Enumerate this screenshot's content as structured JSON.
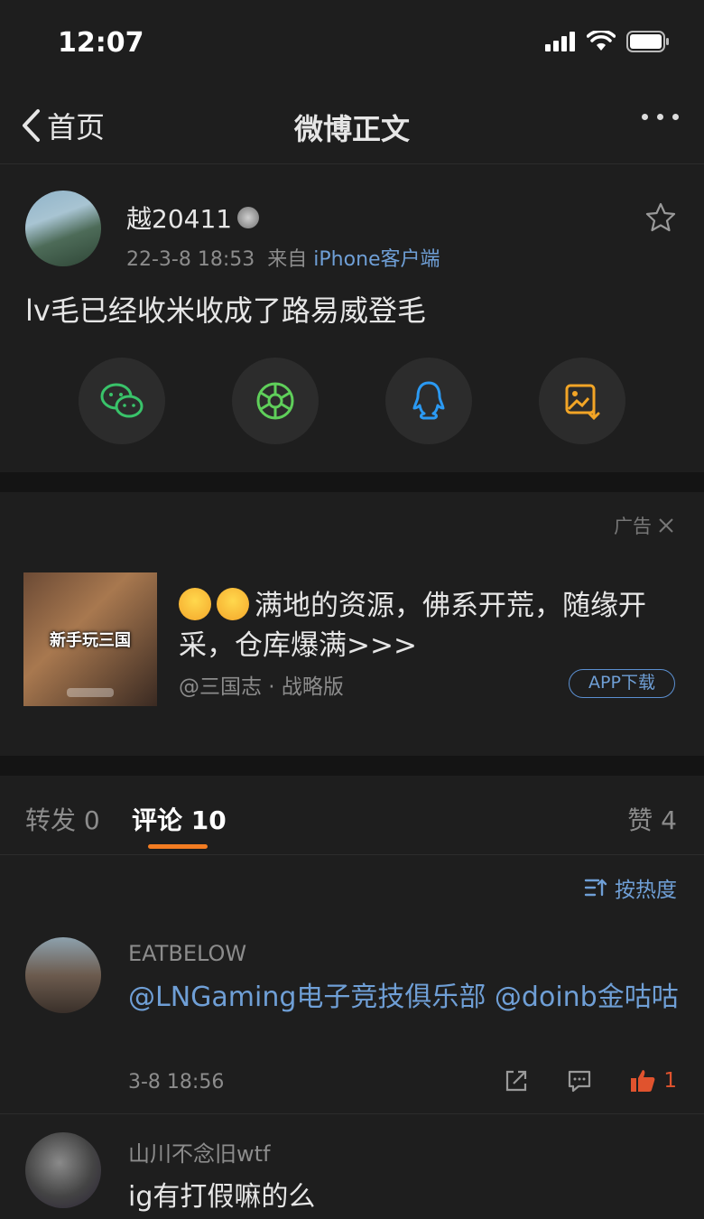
{
  "status_bar": {
    "time": "12:07"
  },
  "nav": {
    "back_label": "首页",
    "title": "微博正文"
  },
  "post": {
    "author": "越20411",
    "time": "22-3-8 18:53",
    "source_prefix": "来自",
    "source": "iPhone客户端",
    "text": "lv毛已经收米收成了路易威登毛",
    "share_icons": [
      "wechat-icon",
      "moments-icon",
      "qq-icon",
      "save-image-icon"
    ]
  },
  "ad": {
    "tag": "广告",
    "image_label": "新手玩三国",
    "text": "满地的资源，佛系开荒，随缘开采，仓库爆满>>>",
    "source": "@三国志 · 战略版",
    "button": "APP下载"
  },
  "tabs": {
    "repost_label": "转发",
    "repost_count": "0",
    "comments_label": "评论",
    "comments_count": "10",
    "likes_label": "赞",
    "likes_count": "4"
  },
  "sort_label": "按热度",
  "comments": [
    {
      "name": "EATBELOW",
      "text": "@LNGaming电子竞技俱乐部 @doinb金咕咕",
      "time": "3-8 18:56",
      "likes": "1"
    },
    {
      "name": "山川不念旧wtf",
      "text": "ig有打假嘛的么"
    }
  ],
  "colors": {
    "accent_orange": "#f27c22",
    "link_blue": "#6f9fd6",
    "like_red": "#e0532e"
  }
}
